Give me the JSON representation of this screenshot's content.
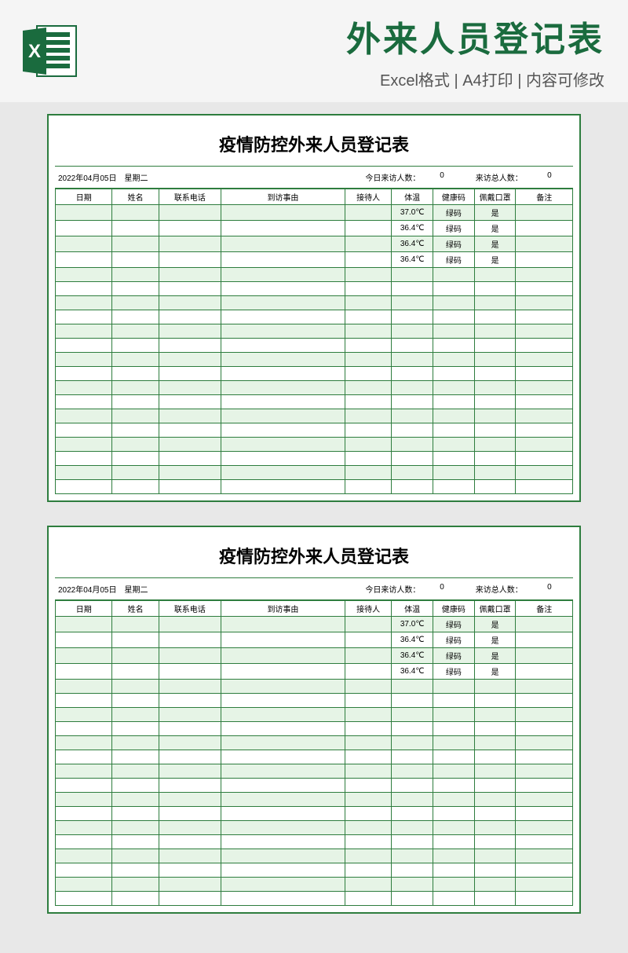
{
  "header": {
    "main_title": "外来人员登记表",
    "subtitle": "Excel格式 | A4打印 | 内容可修改"
  },
  "sheet": {
    "title": "疫情防控外来人员登记表",
    "date_info": "2022年04月05日　星期二",
    "today_visitor_label": "今日来访人数：",
    "today_visitor_count": "0",
    "total_visitor_label": "来访总人数：",
    "total_visitor_count": "0",
    "columns": {
      "date": "日期",
      "name": "姓名",
      "phone": "联系电话",
      "reason": "到访事由",
      "host": "接待人",
      "temp": "体温",
      "health": "健康码",
      "mask": "佩戴口罩",
      "note": "备注"
    },
    "rows": [
      {
        "temp": "37.0℃",
        "health": "绿码",
        "mask": "是"
      },
      {
        "temp": "36.4℃",
        "health": "绿码",
        "mask": "是"
      },
      {
        "temp": "36.4℃",
        "health": "绿码",
        "mask": "是"
      },
      {
        "temp": "36.4℃",
        "health": "绿码",
        "mask": "是"
      }
    ],
    "empty_rows": 16
  }
}
